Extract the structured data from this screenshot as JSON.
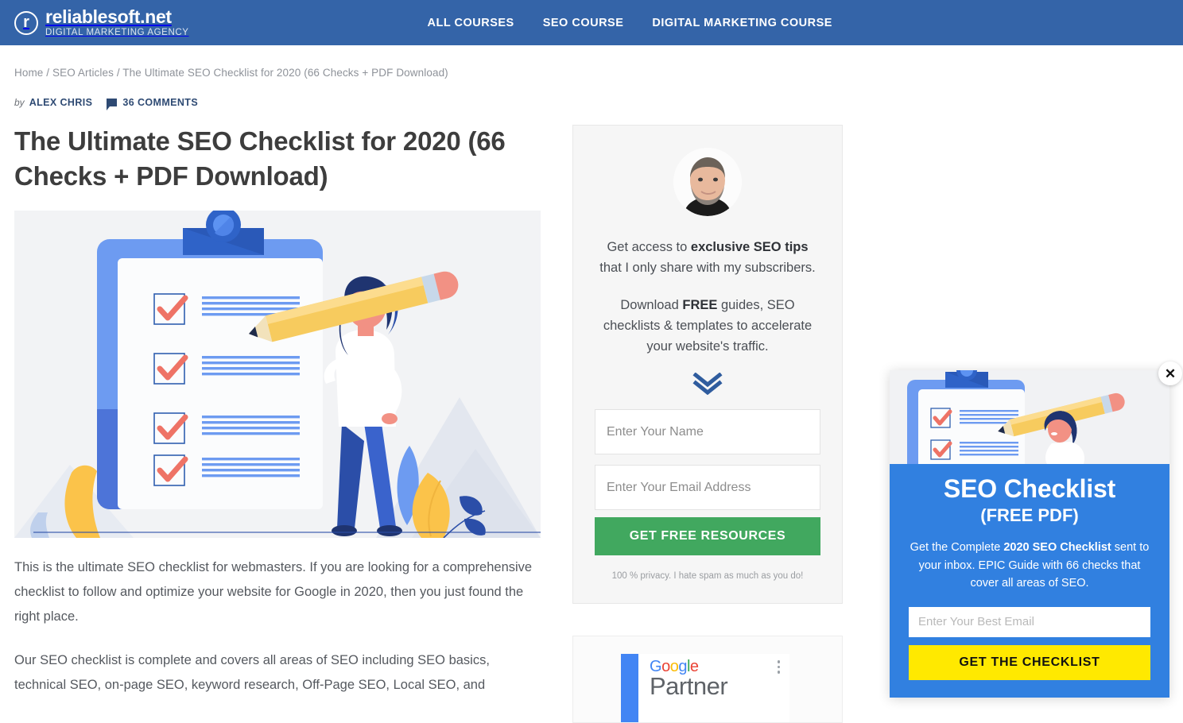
{
  "header": {
    "brand_initial": "r",
    "brand_name": "reliablesoft.net",
    "brand_tagline": "DIGITAL MARKETING AGENCY",
    "nav": [
      {
        "label": "ALL COURSES"
      },
      {
        "label": "SEO COURSE"
      },
      {
        "label": "DIGITAL MARKETING COURSE"
      }
    ],
    "bg_color": "#3464a8"
  },
  "breadcrumb": {
    "home": "Home",
    "sep1": " / ",
    "category": "SEO Articles",
    "sep2": " / ",
    "current": "The Ultimate SEO Checklist for 2020 (66 Checks + PDF Download)"
  },
  "byline": {
    "by": "by",
    "author": "ALEX CHRIS",
    "comments": "36 COMMENTS"
  },
  "article": {
    "title": "The Ultimate SEO Checklist for 2020 (66 Checks + PDF Download)",
    "paragraphs": [
      "This is the ultimate SEO checklist for webmasters. If you are looking for a comprehensive checklist to follow and optimize your website for Google in 2020, then you just found the right place.",
      "Our SEO checklist is complete and covers all areas of SEO including SEO basics, technical SEO, on-page SEO, keyword research, Off-Page SEO, Local SEO, and"
    ]
  },
  "sidebar": {
    "optin": {
      "line1_a": "Get access to ",
      "line1_b": "exclusive SEO tips",
      "line1_c": " that I only share with my subscribers.",
      "line2_a": "Download ",
      "line2_b": "FREE",
      "line2_c": " guides, SEO checklists & templates to accelerate your website's traffic.",
      "name_placeholder": "Enter Your Name",
      "email_placeholder": "Enter Your Email Address",
      "button": "GET FREE RESOURCES",
      "privacy": "100 % privacy. I hate spam as much as you do!",
      "button_color": "#41a85f"
    },
    "partner": {
      "google_g": "G",
      "google_o1": "o",
      "google_o2": "o",
      "google_g2": "g",
      "google_l": "l",
      "google_e": "e",
      "partner": "Partner"
    }
  },
  "popup": {
    "title": "SEO Checklist",
    "subtitle": "(FREE PDF)",
    "body_a": "Get the Complete ",
    "body_b": "2020 SEO Checklist",
    "body_c": " sent to your inbox. EPIC Guide with 66 checks that cover all areas of SEO.",
    "email_placeholder": "Enter Your Best Email",
    "button": "GET THE CHECKLIST",
    "close": "✕",
    "bg_color": "#3180e0",
    "button_color": "#ffe900"
  }
}
